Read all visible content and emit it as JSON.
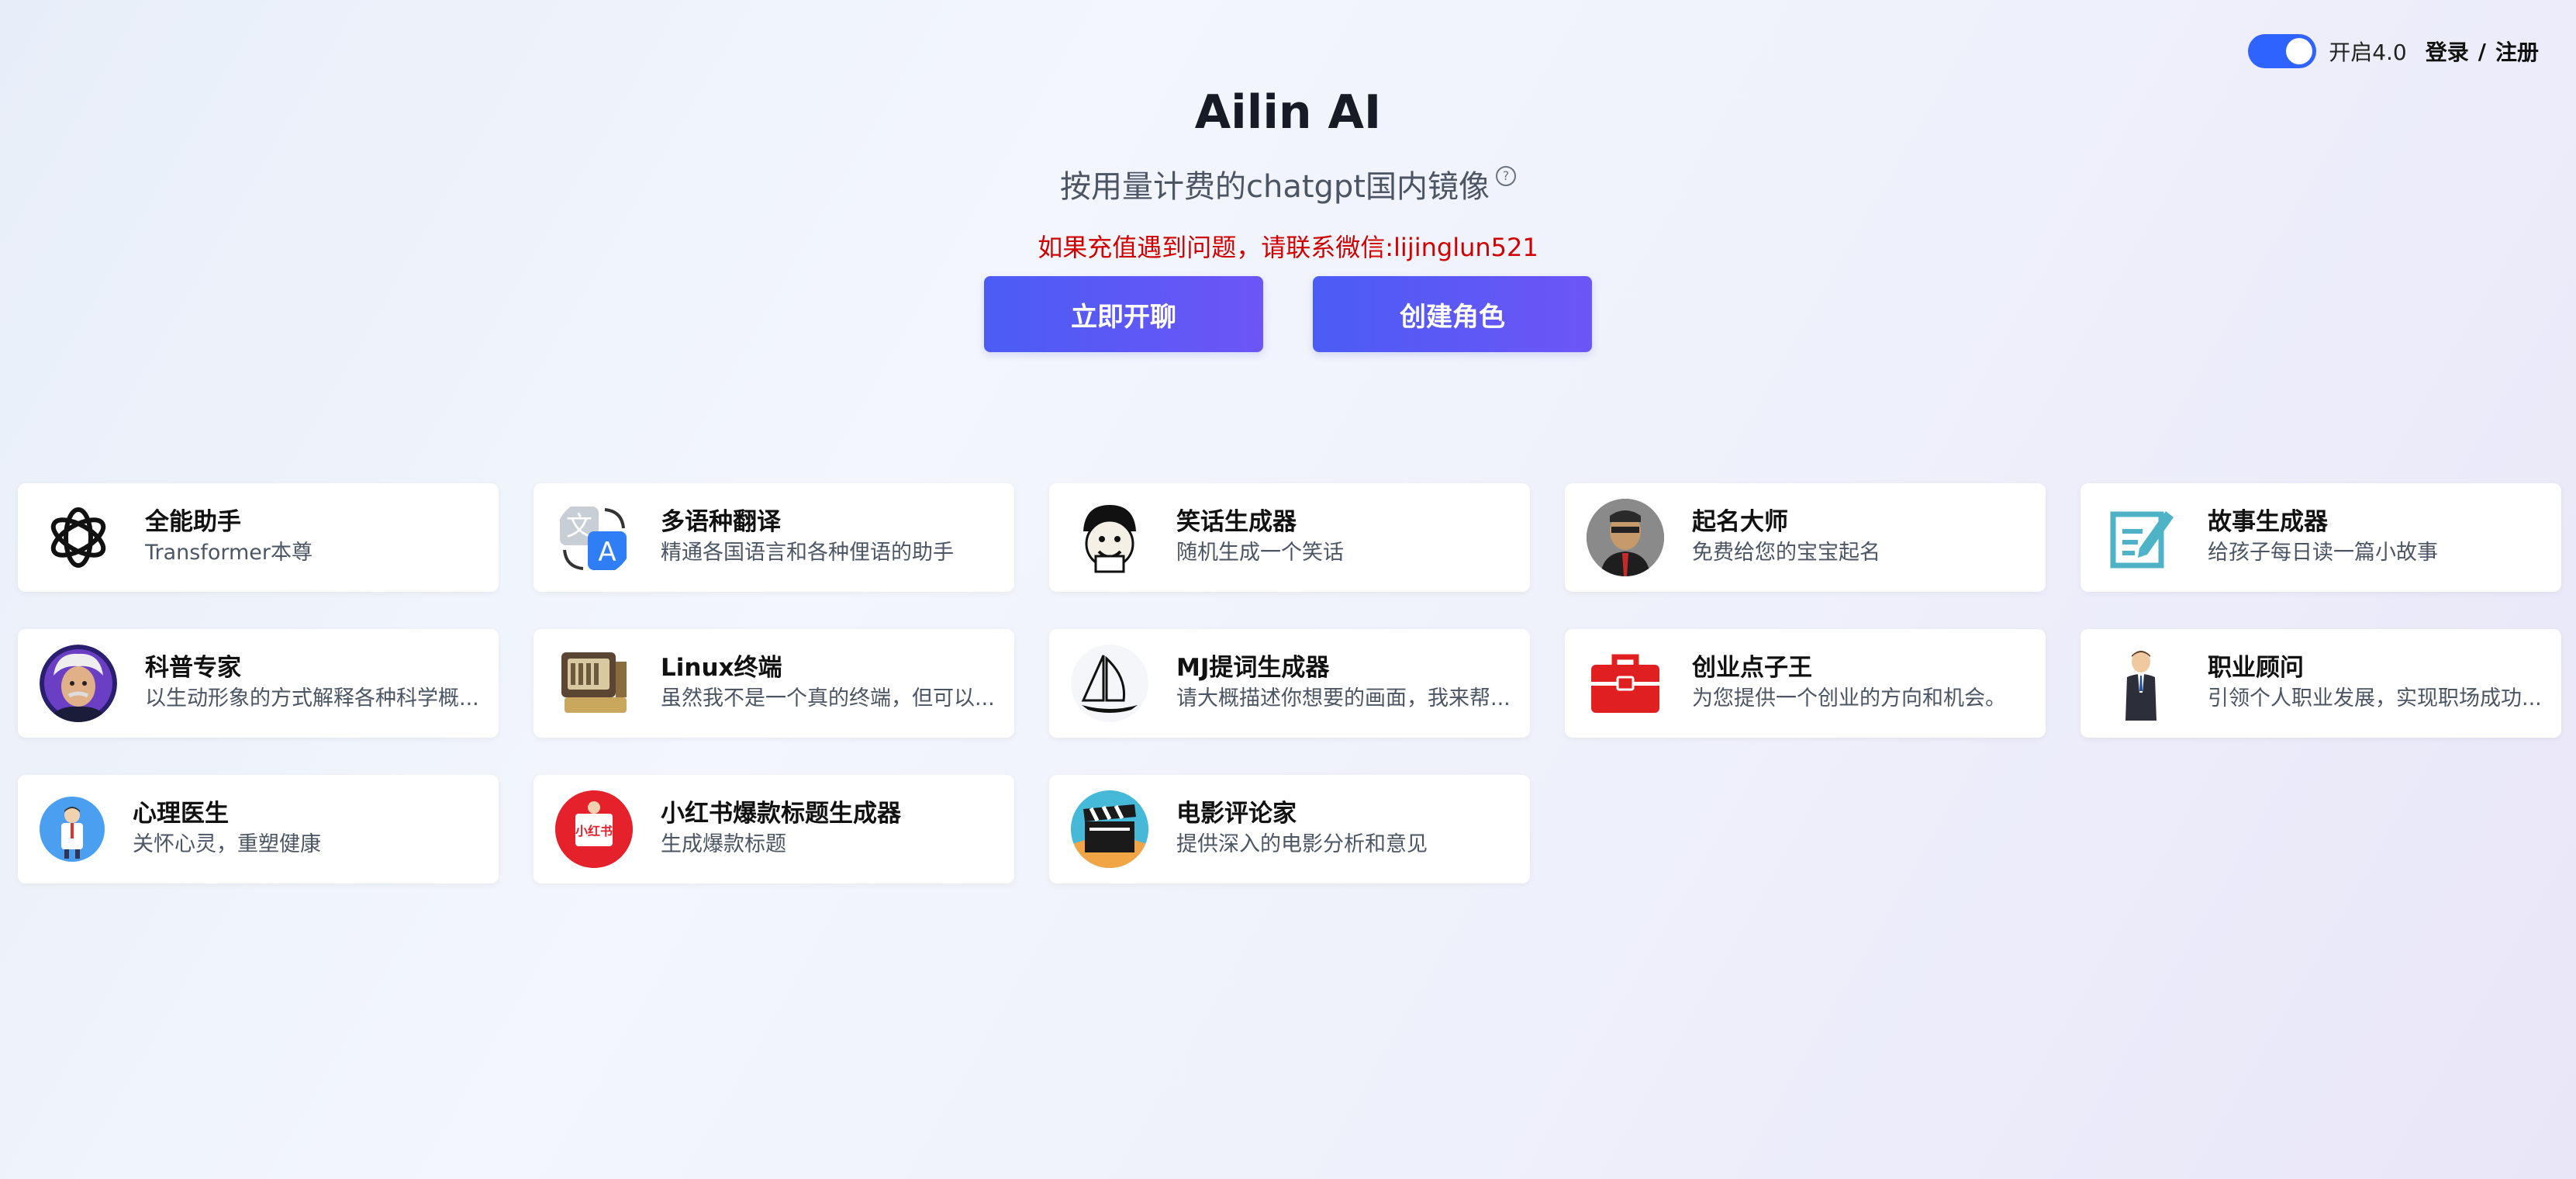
{
  "header": {
    "toggle_label": "开启4.0",
    "login_label": "登录",
    "separator": "/",
    "register_label": "注册"
  },
  "hero": {
    "title": "Ailin AI",
    "subtitle": "按用量计费的chatgpt国内镜像",
    "help_glyph": "?",
    "notice": "如果充值遇到问题，请联系微信:lijinglun521",
    "start_chat_label": "立即开聊",
    "create_role_label": "创建角色"
  },
  "colors": {
    "accent": "#2f63ff",
    "button_gradient_start": "#4b5cf5",
    "button_gradient_end": "#6d55f6",
    "notice": "#d00000"
  },
  "cards": [
    {
      "title": "全能助手",
      "desc": "Transformer本尊",
      "icon": "openai-logo-icon"
    },
    {
      "title": "多语种翻译",
      "desc": "精通各国语言和各种俚语的助手",
      "icon": "translate-icon"
    },
    {
      "title": "笑话生成器",
      "desc": "随机生成一个笑话",
      "icon": "meme-face-icon"
    },
    {
      "title": "起名大师",
      "desc": "免费给您的宝宝起名",
      "icon": "portrait-avatar-icon"
    },
    {
      "title": "故事生成器",
      "desc": "给孩子每日读一篇小故事",
      "icon": "edit-note-icon"
    },
    {
      "title": "科普专家",
      "desc": "以生动形象的方式解释各种科学概...",
      "icon": "scientist-avatar-icon"
    },
    {
      "title": "Linux终端",
      "desc": "虽然我不是一个真的终端，但可以...",
      "icon": "retro-computer-icon"
    },
    {
      "title": "MJ提词生成器",
      "desc": "请大概描述你想要的画面，我来帮...",
      "icon": "sailboat-icon"
    },
    {
      "title": "创业点子王",
      "desc": "为您提供一个创业的方向和机会。",
      "icon": "toolbox-icon"
    },
    {
      "title": "职业顾问",
      "desc": "引领个人职业发展，实现职场成功...",
      "icon": "businessman-icon"
    },
    {
      "title": "心理医生",
      "desc": "关怀心灵，重塑健康",
      "icon": "doctor-icon"
    },
    {
      "title": "小红书爆款标题生成器",
      "desc": "生成爆款标题",
      "icon": "xiaohongshu-logo-icon",
      "icon_text": "小红书"
    },
    {
      "title": "电影评论家",
      "desc": "提供深入的电影分析和意见",
      "icon": "clapperboard-icon"
    }
  ]
}
